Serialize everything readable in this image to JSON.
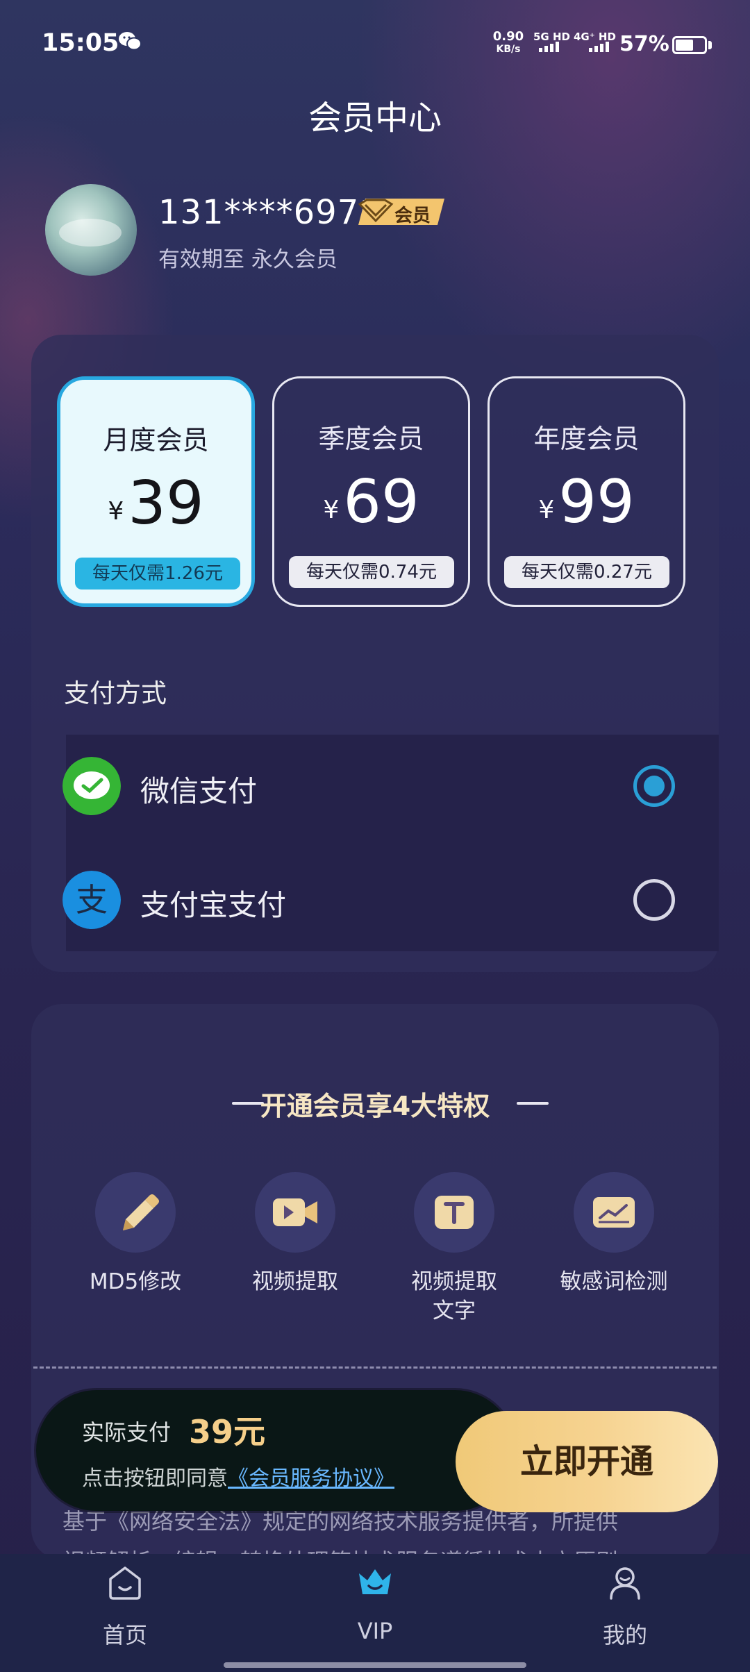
{
  "status_bar": {
    "time": "15:05",
    "net_speed_value": "0.90",
    "net_speed_unit": "KB/s",
    "sim1": "5G HD",
    "sim2": "4G⁺ HD",
    "battery": "57%"
  },
  "header": {
    "title": "会员中心"
  },
  "user": {
    "phone": "131****6971",
    "badge": "会员",
    "expire": "有效期至 永久会员"
  },
  "plans": [
    {
      "name": "月度会员",
      "currency": "¥",
      "price": "39",
      "daily": "每天仅需1.26元",
      "selected": true
    },
    {
      "name": "季度会员",
      "currency": "¥",
      "price": "69",
      "daily": "每天仅需0.74元",
      "selected": false
    },
    {
      "name": "年度会员",
      "currency": "¥",
      "price": "99",
      "daily": "每天仅需0.27元",
      "selected": false
    }
  ],
  "payment": {
    "title": "支付方式",
    "methods": [
      {
        "label": "微信支付",
        "icon": "wechat-pay-icon",
        "selected": true
      },
      {
        "label": "支付宝支付",
        "icon": "alipay-icon",
        "selected": false
      }
    ]
  },
  "privileges": {
    "title": "开通会员享4大特权",
    "items": [
      {
        "label": "MD5修改",
        "icon": "pencil-icon"
      },
      {
        "label": "视频提取",
        "icon": "video-camera-icon"
      },
      {
        "label": "视频提取\n文字",
        "icon": "text-t-icon"
      },
      {
        "label": "敏感词检测",
        "icon": "chart-line-icon"
      }
    ]
  },
  "agreement_text": {
    "line1": "基于《网络安全法》规定的网络技术服务提供者，所提供",
    "line2": "视频解析、编辑、转换处理等技术服务遵循技术中立原则"
  },
  "pay_bar": {
    "actual_label": "实际支付",
    "amount": "39元",
    "agree_prefix": "点击按钮即同意",
    "agree_link": "《会员服务协议》",
    "open_button": "立即开通"
  },
  "bottom_nav": {
    "items": [
      {
        "label": "首页",
        "icon": "home-icon",
        "active": false
      },
      {
        "label": "VIP",
        "icon": "crown-icon",
        "active": true
      },
      {
        "label": "我的",
        "icon": "profile-icon",
        "active": false
      }
    ]
  },
  "colors": {
    "accent_blue": "#2a9fd6",
    "gold": "#f5cf8a",
    "background": "#2a2652"
  }
}
